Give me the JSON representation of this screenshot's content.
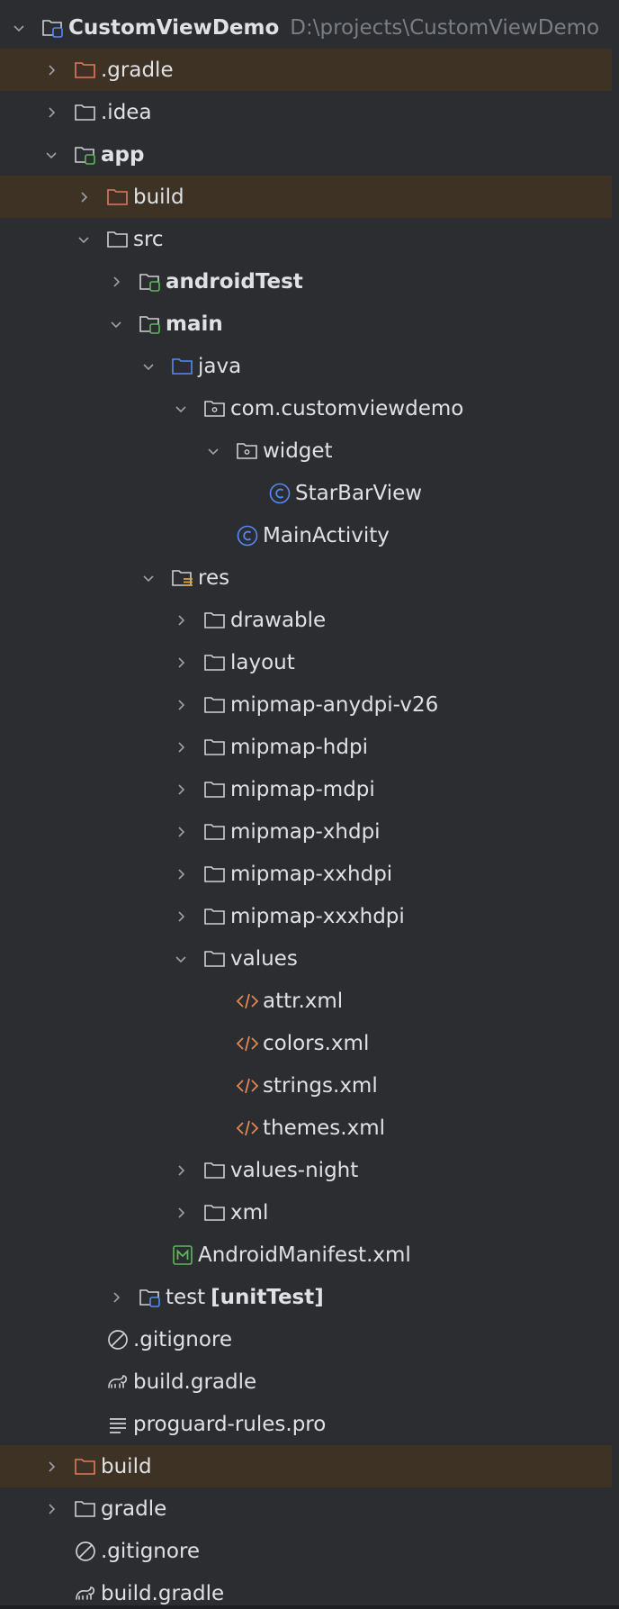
{
  "project_tree": {
    "root": {
      "label": "CustomViewDemo",
      "path": "D:\\projects\\CustomViewDemo"
    },
    "items": [
      {
        "label": ".gradle"
      },
      {
        "label": ".idea"
      },
      {
        "label": "app"
      },
      {
        "label": "build"
      },
      {
        "label": "src"
      },
      {
        "label": "androidTest"
      },
      {
        "label": "main"
      },
      {
        "label": "java"
      },
      {
        "label": "com.customviewdemo"
      },
      {
        "label": "widget"
      },
      {
        "label": "StarBarView"
      },
      {
        "label": "MainActivity"
      },
      {
        "label": "res"
      },
      {
        "label": "drawable"
      },
      {
        "label": "layout"
      },
      {
        "label": "mipmap-anydpi-v26"
      },
      {
        "label": "mipmap-hdpi"
      },
      {
        "label": "mipmap-mdpi"
      },
      {
        "label": "mipmap-xhdpi"
      },
      {
        "label": "mipmap-xxhdpi"
      },
      {
        "label": "mipmap-xxxhdpi"
      },
      {
        "label": "values"
      },
      {
        "label": "attr.xml"
      },
      {
        "label": "colors.xml"
      },
      {
        "label": "strings.xml"
      },
      {
        "label": "themes.xml"
      },
      {
        "label": "values-night"
      },
      {
        "label": "xml"
      },
      {
        "label": "AndroidManifest.xml"
      },
      {
        "label": "test",
        "tag": "[unitTest]"
      },
      {
        "label": ".gitignore"
      },
      {
        "label": "build.gradle"
      },
      {
        "label": "proguard-rules.pro"
      },
      {
        "label": "build"
      },
      {
        "label": "gradle"
      },
      {
        "label": ".gitignore"
      },
      {
        "label": "build.gradle"
      }
    ]
  },
  "colors": {
    "background": "#2b2d30",
    "text": "#dfe1e5",
    "muted_text": "#7a7e85",
    "excluded_row": "#3d3223",
    "excluded_folder": "#e07a5f",
    "source_folder": "#548af7",
    "module_badge": "#5fb85f",
    "xml_icon": "#e08855",
    "class_icon": "#548af7"
  }
}
